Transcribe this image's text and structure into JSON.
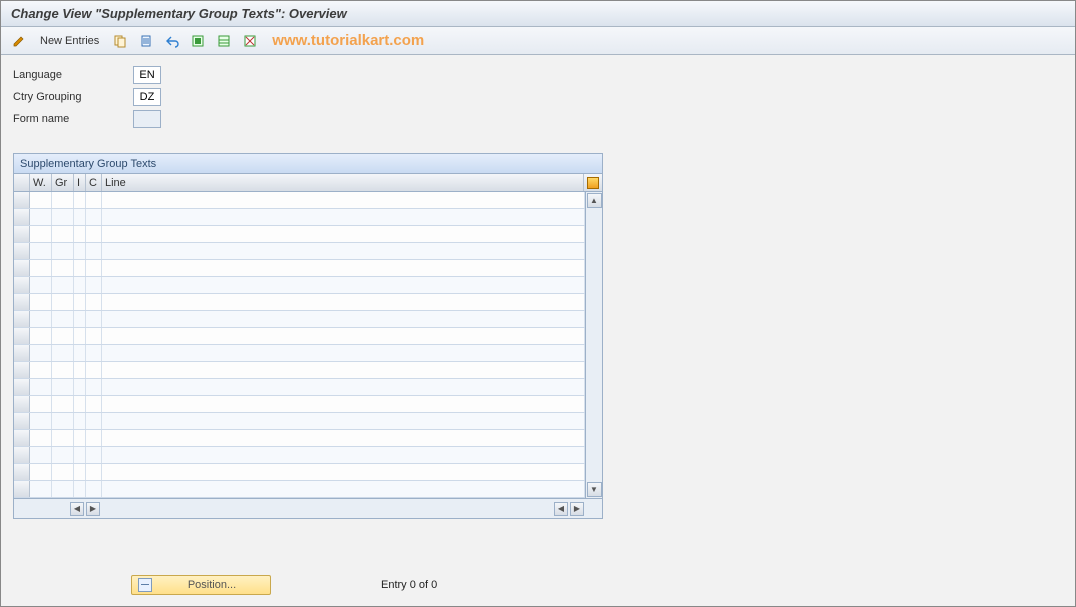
{
  "title": "Change View \"Supplementary Group Texts\": Overview",
  "toolbar": {
    "new_entries_label": "New Entries",
    "watermark": "www.tutorialkart.com"
  },
  "fields": {
    "language_label": "Language",
    "language_value": "EN",
    "ctry_grouping_label": "Ctry Grouping",
    "ctry_grouping_value": "DZ",
    "form_name_label": "Form name",
    "form_name_value": ""
  },
  "grid": {
    "title": "Supplementary Group Texts",
    "columns": {
      "w": "W.",
      "gr": "Gr",
      "i": "I",
      "c": "C",
      "line": "Line"
    },
    "row_count": 18
  },
  "status": {
    "position_label": "Position...",
    "entry_label": "Entry 0 of 0"
  }
}
